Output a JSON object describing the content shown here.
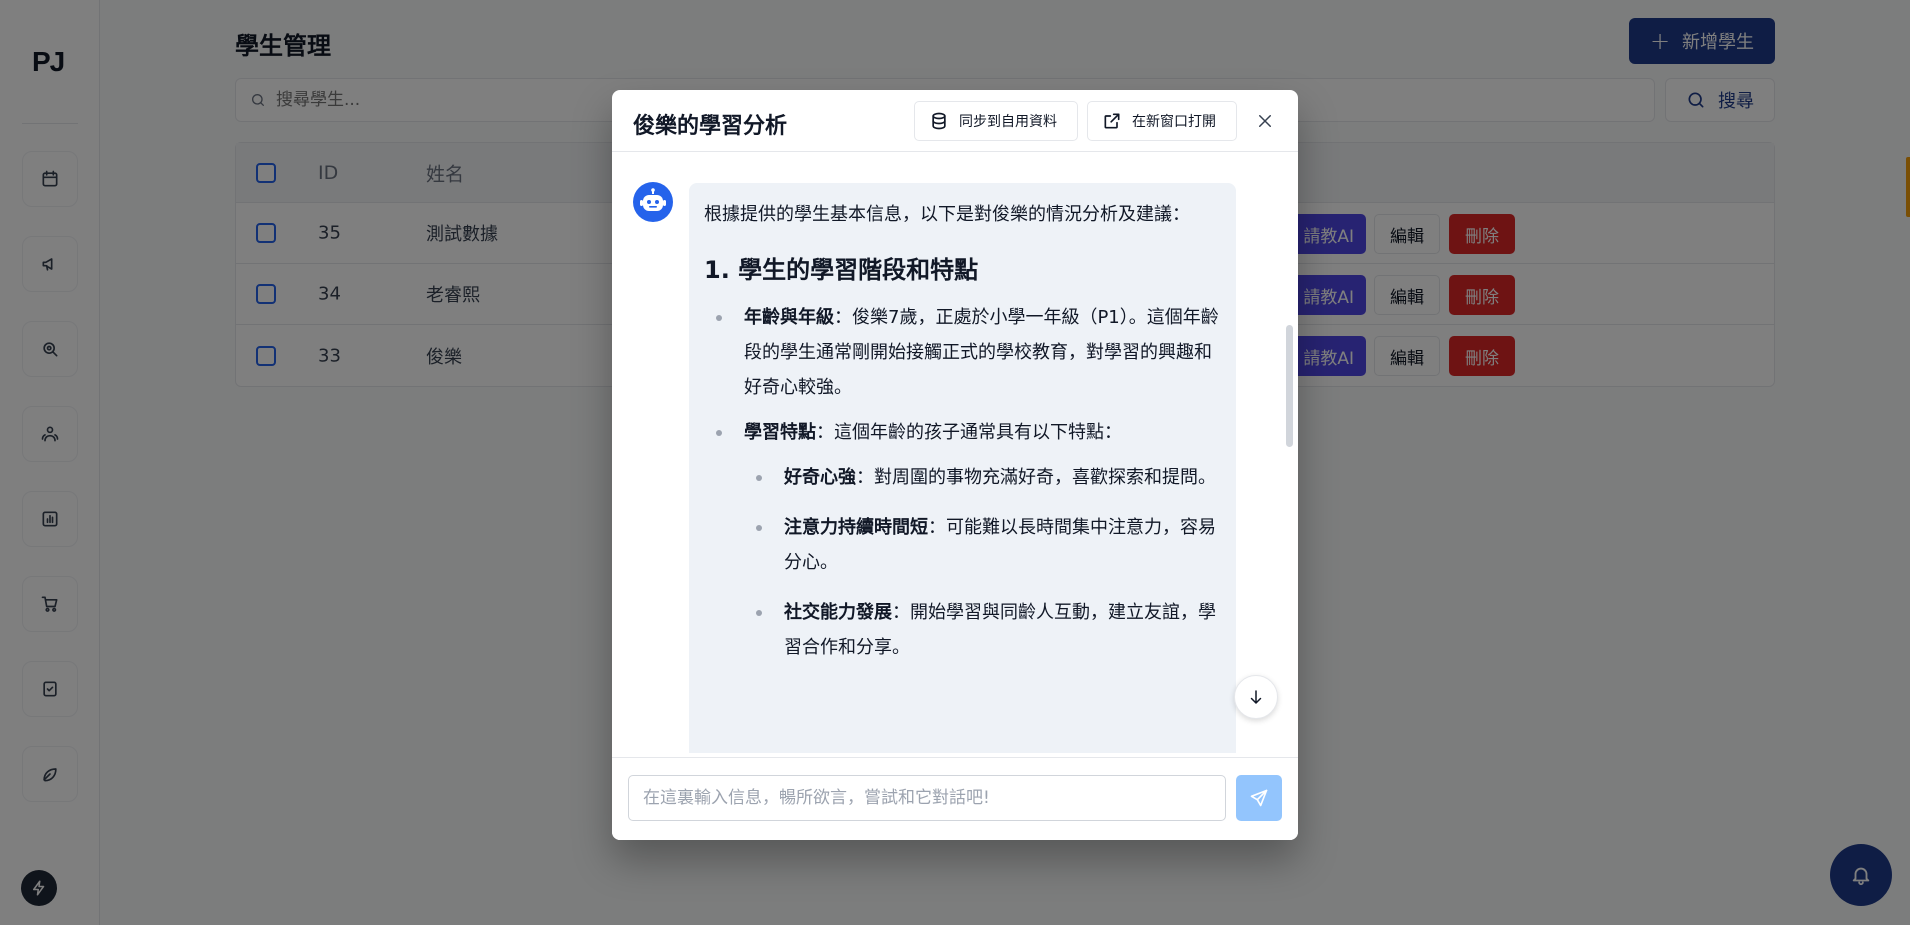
{
  "app": {
    "logo": "PJ"
  },
  "sidebar": {
    "items": [
      {
        "icon": "calendar-icon"
      },
      {
        "icon": "megaphone-icon"
      },
      {
        "icon": "search-zoom-icon"
      },
      {
        "icon": "users-icon"
      },
      {
        "icon": "bar-chart-icon"
      },
      {
        "icon": "cart-icon"
      },
      {
        "icon": "checklist-icon"
      },
      {
        "icon": "leaf-icon"
      }
    ]
  },
  "page": {
    "title": "學生管理",
    "add_button_label": "新增學生",
    "search_placeholder": "搜尋學生...",
    "search_button_label": "搜尋"
  },
  "table": {
    "headers": {
      "id": "ID",
      "name": "姓名"
    },
    "rows": [
      {
        "id": "35",
        "name": "測試數據"
      },
      {
        "id": "34",
        "name": "老睿熙"
      },
      {
        "id": "33",
        "name": "俊樂"
      }
    ],
    "actions": {
      "ai": "請教AI",
      "edit": "編輯",
      "delete": "刪除"
    }
  },
  "modal": {
    "title": "俊樂的學習分析",
    "sync_button_label": "同步到自用資料",
    "open_window_button_label": "在新窗口打開",
    "message": {
      "intro": "根據提供的學生基本信息，以下是對俊樂的情況分析及建議：",
      "section1_title": "1. 學生的學習階段和特點",
      "item1_label": "年齡與年級",
      "item1_text": "：俊樂7歲，正處於小學一年級（P1）。這個年齡段的學生通常剛開始接觸正式的學校教育，對學習的興趣和好奇心較強。",
      "item2_label": "學習特點",
      "item2_text": "：這個年齡的孩子通常具有以下特點：",
      "sub1_label": "好奇心強",
      "sub1_text": "：對周圍的事物充滿好奇，喜歡探索和提問。",
      "sub2_label": "注意力持續時間短",
      "sub2_text": "：可能難以長時間集中注意力，容易分心。",
      "sub3_label": "社交能力發展",
      "sub3_text": "：開始學習與同齡人互動，建立友誼，學習合作和分享。"
    },
    "input_placeholder": "在這裏輸入信息，暢所欲言，嘗試和它對話吧!"
  },
  "colors": {
    "primary": "#1e3a8a",
    "ai_button": "#4f46e5",
    "delete_button": "#dc2626",
    "send_button": "#93c5fd",
    "bot_avatar": "#2563eb"
  }
}
